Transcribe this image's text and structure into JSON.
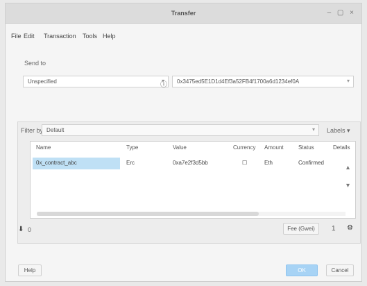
{
  "window": {
    "title": "Transfer",
    "controls": "– ▢ ×"
  },
  "menu": [
    "File",
    "Edit",
    "Transaction",
    "Tools",
    "Help"
  ],
  "transfer_section": {
    "heading": "Send to",
    "recipient": "Unspecified",
    "address": "0x3475ed5E1D1d4Ef3a52FB4f1700a6d1234ef0A",
    "mid_icon": "ⓘ"
  },
  "filter_bar": {
    "label": "Filter by",
    "value": "Default",
    "right_label": "Labels ▾"
  },
  "table": {
    "columns": [
      "Name",
      "Type",
      "Value",
      "Currency",
      "Amount",
      "Status",
      "Details"
    ],
    "rows": [
      {
        "name": "0x_contract_abc",
        "type": "Erc",
        "value": "0xa7e2f3d5bb",
        "currency": "☐",
        "amount": "Eth",
        "status": "Confirmed",
        "details": ""
      }
    ]
  },
  "bottom_controls": {
    "left_icon": "⬇",
    "left_value": "0",
    "fee_label": "Fee (Gwei)",
    "right_value": "1"
  },
  "footer": {
    "help": "Help",
    "ok": "OK",
    "cancel": "Cancel"
  }
}
